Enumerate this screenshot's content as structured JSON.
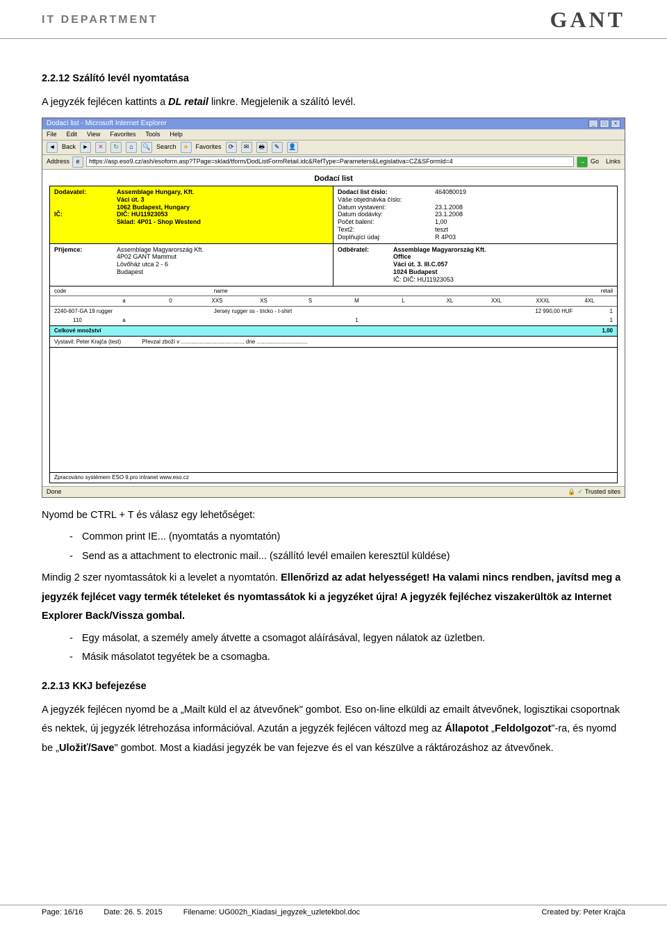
{
  "header": {
    "department": "IT DEPARTMENT",
    "logo": "GANT"
  },
  "section1": {
    "num_title": "2.2.12 Szálító levél nyomtatása",
    "intro_a": "A jegyzék fejlécen kattints a ",
    "intro_b": "DL retail",
    "intro_c": " linkre. Megjelenik a szálító levél."
  },
  "ie": {
    "title": "Dodací list - Microsoft Internet Explorer",
    "menu": [
      "File",
      "Edit",
      "View",
      "Favorites",
      "Tools",
      "Help"
    ],
    "toolbar": {
      "back": "Back",
      "search": "Search",
      "favorites": "Favorites"
    },
    "addr_label": "Address",
    "url": "https://asp.eso9.cz/ash/esoform.asp?TPage=sklad/tform/DodListFormRetail.idc&RefType=Parameters&Legislativa=CZ&SFormId=4",
    "go": "Go",
    "links": "Links",
    "status_done": "Done",
    "status_trusted": "Trusted sites"
  },
  "doc": {
    "title": "Dodací list",
    "left_top": {
      "dodavatel_lbl": "Dodavatel:",
      "company": "Assemblage Hungary, Kft.",
      "street": "Váci út. 3",
      "city": "1062 Budapest, Hungary",
      "ic": "IČ:",
      "dic": "DIČ: HU11923053",
      "sklad": "Sklad: 4P01 - Shop Westend"
    },
    "right_top": {
      "cislo_lbl": "Dodací list číslo:",
      "cislo_val": "464080019",
      "obj_lbl": "Váše objednávka číslo:",
      "datvy_lbl": "Datum vystavení:",
      "datvy_val": "23.1.2008",
      "datdod_lbl": "Datum dodávky:",
      "datdod_val": "23.1.2008",
      "pocet_lbl": "Počet balení:",
      "pocet_val": "1,00",
      "text2_lbl": "Text2:",
      "text2_val": "teszt",
      "dopl_lbl": "Doplňující údaj:",
      "dopl_val": "R 4P03"
    },
    "left_bot": {
      "prij_lbl": "Příjemce:",
      "l1": "Assemblage Magyarország Kft.",
      "l2": "4P02 GANT Mammut",
      "l3": "Lövőház utca 2 - 6",
      "l4": "Budapest"
    },
    "right_bot": {
      "odb_lbl": "Odběratel:",
      "l1": "Assemblage Magyarország Kft.",
      "l2": "Office",
      "l3": "Váci út. 3. III.C.057",
      "l4": "1024 Budapest",
      "l5": "IČ:   DIČ: HU11923053"
    },
    "table": {
      "headers1": [
        "code",
        "",
        "",
        "name",
        "",
        "",
        "",
        "",
        "",
        "",
        "",
        "retail"
      ],
      "headers2": [
        "",
        "a",
        "0",
        "XXS",
        "XS",
        "S",
        "M",
        "L",
        "XL",
        "XXL",
        "XXXL",
        "4XL"
      ],
      "row_code": "2240-607-GA 19 rugger",
      "row_name": "Jersey rugger ss - tricko - t-shirt",
      "row_price": "12 990,00 HUF",
      "row_qty": "1",
      "row2": [
        "110",
        "a",
        "",
        "",
        "",
        "",
        "1",
        "",
        "",
        "",
        "",
        "",
        "1"
      ],
      "total_lbl": "Celkové množství",
      "total_val": "1,00"
    },
    "sign": {
      "vystavil": "Vystavil: Peter Krajča (test)",
      "prevzal": "Převzal zboží v ......................................... dne ................................."
    },
    "footer_note": "Zpracováno systémem ESO 9.pro intranet www.eso.cz"
  },
  "body_text": {
    "p1_a": "Nyomd be CTRL + T és válasz egy lehetőséget:",
    "li1_a": "Common print IE... (nyomtatás a nyomtatón)",
    "li2_a": "Send as a attachment to electronic mail... (szállító levél emailen keresztül küldése)",
    "p2": "Mindig 2 szer nyomtassátok ki a levelet a nyomtatón. ",
    "p2b": "Ellenőrizd az adat helyességet! Ha valami nincs rendben, javítsd meg a jegyzék fejlécet vagy termék tételeket és nyomtassátok ki a jegyzéket újra! A jegyzék fejléchez viszakerültök az Internet Explorer Back/Vissza gombal.",
    "li3": "Egy másolat, a személy amely átvette a csomagot aláírásával, legyen nálatok az üzletben.",
    "li4": "Másik másolatot tegyétek be a csomagba."
  },
  "section2": {
    "num_title": "2.2.13 KKJ befejezése",
    "p1": "A jegyzék fejlécen nyomd be a „Mailt küld el az átvevőnek\" gombot. Eso on-line elküldi az emailt átvevőnek, logisztikai csoportnak és nektek, új jegyzék létrehozása információval. ",
    "p2": "Azután a jegyzék fejlécen változd meg az ",
    "p2b": "Állapotot",
    "p2c": " „",
    "p2d": "Feldolgozot",
    "p2e": "\"-ra, és nyomd be „",
    "p2f": "Uložiť/Save",
    "p2g": "\" gombot. Most a kiadási jegyzék be van fejezve és el van készülve a ráktározáshoz az átvevőnek."
  },
  "footer": {
    "page_lbl": "Page: ",
    "page_val": "16/16",
    "date_lbl": "Date: ",
    "date_val": "26. 5. 2015",
    "file_lbl": "Filename: ",
    "file_val": "UG002h_Kiadasi_jegyzek_uzletekbol.doc",
    "creator_lbl": "Created by: ",
    "creator_val": "Peter Krajča"
  }
}
